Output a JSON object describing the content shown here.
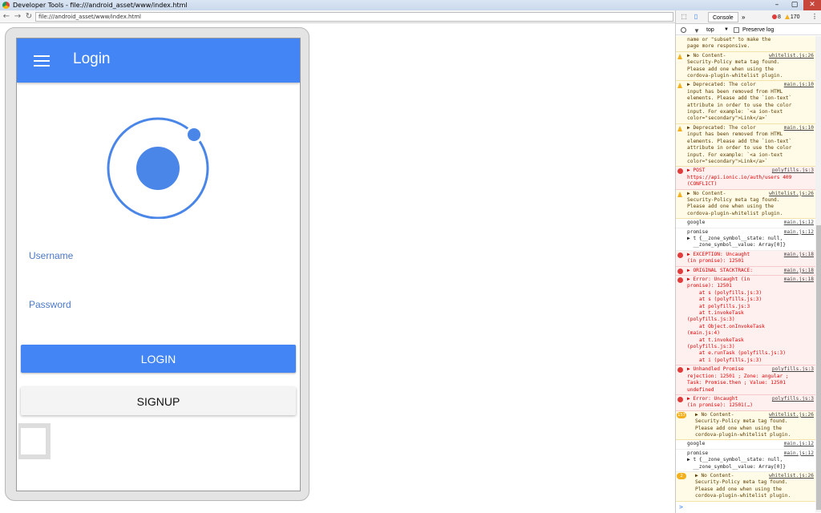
{
  "window": {
    "title": "Developer Tools - file:///android_asset/www/index.html",
    "min": "–",
    "max": "▢",
    "close": "✕"
  },
  "browser": {
    "url": "file:///android_asset/www/index.html",
    "back": "←",
    "forward": "→",
    "reload": "↻"
  },
  "app": {
    "title": "Login",
    "username_label": "Username",
    "password_label": "Password",
    "login_label": "LOGIN",
    "signup_label": "SIGNUP",
    "colors": {
      "primary": "#4385f4",
      "label": "#4a78c8"
    }
  },
  "devtools": {
    "tab": "Console",
    "more": "»",
    "error_count": "8",
    "warning_count": "170",
    "menu": "⋮",
    "context": "top",
    "preserve_log": "Preserve log",
    "prompt": ">",
    "messages": [
      {
        "level": "warn",
        "text": "name or \"subset\" to make the\npage more responsive.",
        "src": "",
        "icon": false
      },
      {
        "level": "warn",
        "text": "▶ No Content-\nSecurity-Policy meta tag found.\nPlease add one when using the\ncordova-plugin-whitelist plugin.",
        "src": "whitelist.js:26",
        "icon": true
      },
      {
        "level": "warn",
        "text": "▶ Deprecated: The color\ninput has been removed from HTML\nelements. Please add the `ion-text`\nattribute in order to use the color\ninput. For example: `<a ion-text\ncolor=\"secondary\">Link</a>`",
        "src": "main.js:10",
        "icon": true
      },
      {
        "level": "warn",
        "text": "▶ Deprecated: The color\ninput has been removed from HTML\nelements. Please add the `ion-text`\nattribute in order to use the color\ninput. For example: `<a ion-text\ncolor=\"secondary\">Link</a>`",
        "src": "main.js:10",
        "icon": true
      },
      {
        "level": "err",
        "text": "▶ POST\nhttps://api.ionic.io/auth/users 409\n(CONFLICT)",
        "src": "polyfills.js:3",
        "icon": true
      },
      {
        "level": "warn",
        "text": "▶ No Content-\nSecurity-Policy meta tag found.\nPlease add one when using the\ncordova-plugin-whitelist plugin.",
        "src": "whitelist.js:26",
        "icon": true
      },
      {
        "level": "log",
        "text": "google",
        "src": "main.js:12",
        "icon": false
      },
      {
        "level": "log",
        "text": "promise\n▶ t {__zone_symbol__state: null,\n  __zone_symbol__value: Array[0]}",
        "src": "main.js:12",
        "icon": false
      },
      {
        "level": "err",
        "text": "▶ EXCEPTION: Uncaught\n(in promise): 12501",
        "src": "main.js:18",
        "icon": true
      },
      {
        "level": "err",
        "text": "▶ ORIGINAL STACKTRACE:",
        "src": "main.js:18",
        "icon": true
      },
      {
        "level": "err",
        "text": "▶ Error: Uncaught (in\npromise): 12501\n    at s (polyfills.js:3)\n    at s (polyfills.js:3)\n    at polyfills.js:3\n    at t.invokeTask\n(polyfills.js:3)\n    at Object.onInvokeTask\n(main.js:4)\n    at t.invokeTask\n(polyfills.js:3)\n    at e.runTask (polyfills.js:3)\n    at i (polyfills.js:3)",
        "src": "main.js:18",
        "icon": true
      },
      {
        "level": "err",
        "text": "▶ Unhandled Promise\nrejection: 12501 ; Zone: angular ;\nTask: Promise.then ; Value: 12501\nundefined",
        "src": "polyfills.js:3",
        "icon": true
      },
      {
        "level": "err",
        "text": "▶ Error: Uncaught\n(in promise): 12501(…)",
        "src": "polyfills.js:3",
        "icon": true
      },
      {
        "level": "warn",
        "text": "▶ No Content-\nSecurity-Policy meta tag found.\nPlease add one when using the\ncordova-plugin-whitelist plugin.",
        "src": "whitelist.js:26",
        "icon": true,
        "badge": "157"
      },
      {
        "level": "log",
        "text": "google",
        "src": "main.js:12",
        "icon": false
      },
      {
        "level": "log",
        "text": "promise\n▶ t {__zone_symbol__state: null,\n  __zone_symbol__value: Array[0]}",
        "src": "main.js:12",
        "icon": false
      },
      {
        "level": "warn",
        "text": "▶ No Content-\nSecurity-Policy meta tag found.\nPlease add one when using the\ncordova-plugin-whitelist plugin.",
        "src": "whitelist.js:26",
        "icon": true,
        "badge": "2"
      }
    ]
  }
}
